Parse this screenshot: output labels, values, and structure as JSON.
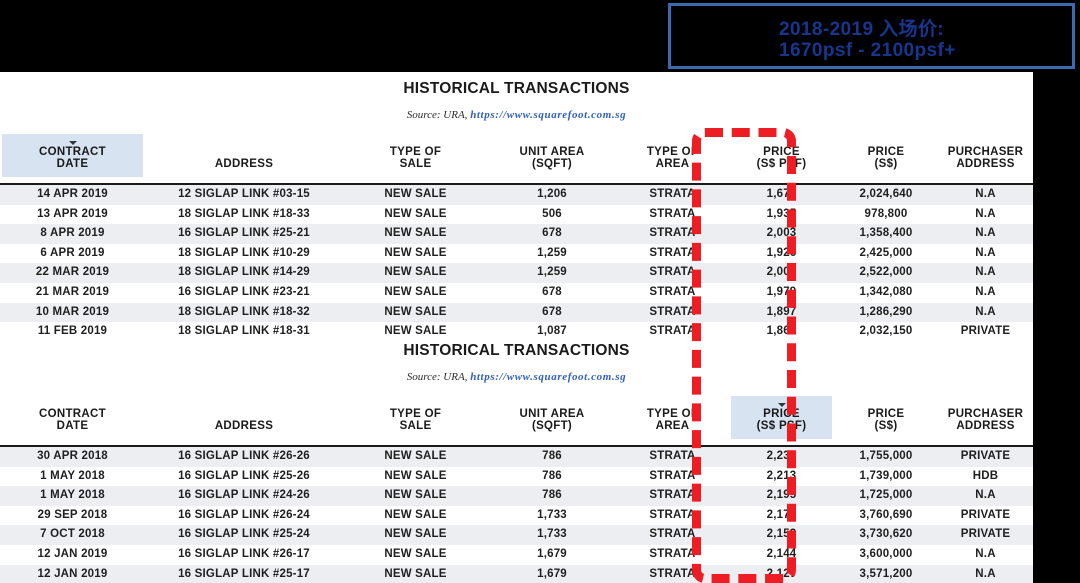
{
  "callout": {
    "line1": "2018-2019  入场价:",
    "line2": "1670psf -  2100psf+",
    "border_color": "#3a6ab0",
    "text_color": "#16368f"
  },
  "highlight": {
    "name": "price-psf-column-highlight",
    "color": "#ee1d24",
    "style": "dashed-rounded-rectangle"
  },
  "tables": [
    {
      "title": "HISTORICAL TRANSACTIONS",
      "source_prefix": "Source: URA,",
      "source_url": "https://www.squarefoot.com.sg",
      "sorted_column": "CONTRACT DATE",
      "columns": [
        {
          "line1": "CONTRACT",
          "line2": "DATE"
        },
        {
          "line1": "ADDRESS",
          "line2": ""
        },
        {
          "line1": "TYPE OF",
          "line2": "SALE"
        },
        {
          "line1": "UNIT AREA",
          "line2": "(SQFT)"
        },
        {
          "line1": "TYPE OF",
          "line2": "AREA"
        },
        {
          "line1": "PRICE",
          "line2": "(S$ PSF)"
        },
        {
          "line1": "PRICE",
          "line2": "(S$)"
        },
        {
          "line1": "PURCHASER",
          "line2": "ADDRESS"
        }
      ],
      "rows": [
        [
          "14 APR 2019",
          "12 SIGLAP LINK #03-15",
          "NEW SALE",
          "1,206",
          "STRATA",
          "1,679",
          "2,024,640",
          "N.A"
        ],
        [
          "13 APR 2019",
          "18 SIGLAP LINK #18-33",
          "NEW SALE",
          "506",
          "STRATA",
          "1,935",
          "978,800",
          "N.A"
        ],
        [
          "8 APR 2019",
          "16 SIGLAP LINK #25-21",
          "NEW SALE",
          "678",
          "STRATA",
          "2,003",
          "1,358,400",
          "N.A"
        ],
        [
          "6 APR 2019",
          "18 SIGLAP LINK #10-29",
          "NEW SALE",
          "1,259",
          "STRATA",
          "1,926",
          "2,425,000",
          "N.A"
        ],
        [
          "22 MAR 2019",
          "18 SIGLAP LINK #14-29",
          "NEW SALE",
          "1,259",
          "STRATA",
          "2,003",
          "2,522,000",
          "N.A"
        ],
        [
          "21 MAR 2019",
          "16 SIGLAP LINK #23-21",
          "NEW SALE",
          "678",
          "STRATA",
          "1,979",
          "1,342,080",
          "N.A"
        ],
        [
          "10 MAR 2019",
          "18 SIGLAP LINK #18-32",
          "NEW SALE",
          "678",
          "STRATA",
          "1,897",
          "1,286,290",
          "N.A"
        ],
        [
          "11 FEB 2019",
          "18 SIGLAP LINK #18-31",
          "NEW SALE",
          "1,087",
          "STRATA",
          "1,869",
          "2,032,150",
          "PRIVATE"
        ]
      ]
    },
    {
      "title": "HISTORICAL TRANSACTIONS",
      "source_prefix": "Source: URA,",
      "source_url": "https://www.squarefoot.com.sg",
      "sorted_column": "PRICE (S$ PSF)",
      "columns": [
        {
          "line1": "CONTRACT",
          "line2": "DATE"
        },
        {
          "line1": "ADDRESS",
          "line2": ""
        },
        {
          "line1": "TYPE OF",
          "line2": "SALE"
        },
        {
          "line1": "UNIT AREA",
          "line2": "(SQFT)"
        },
        {
          "line1": "TYPE OF",
          "line2": "AREA"
        },
        {
          "line1": "PRICE",
          "line2": "(S$ PSF)"
        },
        {
          "line1": "PRICE",
          "line2": "(S$)"
        },
        {
          "line1": "PURCHASER",
          "line2": "ADDRESS"
        }
      ],
      "rows": [
        [
          "30 APR 2018",
          "16 SIGLAP LINK #26-26",
          "NEW SALE",
          "786",
          "STRATA",
          "2,233",
          "1,755,000",
          "PRIVATE"
        ],
        [
          "1 MAY 2018",
          "16 SIGLAP LINK #25-26",
          "NEW SALE",
          "786",
          "STRATA",
          "2,213",
          "1,739,000",
          "HDB"
        ],
        [
          "1 MAY 2018",
          "16 SIGLAP LINK #24-26",
          "NEW SALE",
          "786",
          "STRATA",
          "2,195",
          "1,725,000",
          "N.A"
        ],
        [
          "29 SEP 2018",
          "16 SIGLAP LINK #26-24",
          "NEW SALE",
          "1,733",
          "STRATA",
          "2,170",
          "3,760,690",
          "PRIVATE"
        ],
        [
          "7 OCT 2018",
          "16 SIGLAP LINK #25-24",
          "NEW SALE",
          "1,733",
          "STRATA",
          "2,153",
          "3,730,620",
          "PRIVATE"
        ],
        [
          "12 JAN 2019",
          "16 SIGLAP LINK #26-17",
          "NEW SALE",
          "1,679",
          "STRATA",
          "2,144",
          "3,600,000",
          "N.A"
        ],
        [
          "12 JAN 2019",
          "16 SIGLAP LINK #25-17",
          "NEW SALE",
          "1,679",
          "STRATA",
          "2,127",
          "3,571,200",
          "N.A"
        ]
      ]
    }
  ]
}
